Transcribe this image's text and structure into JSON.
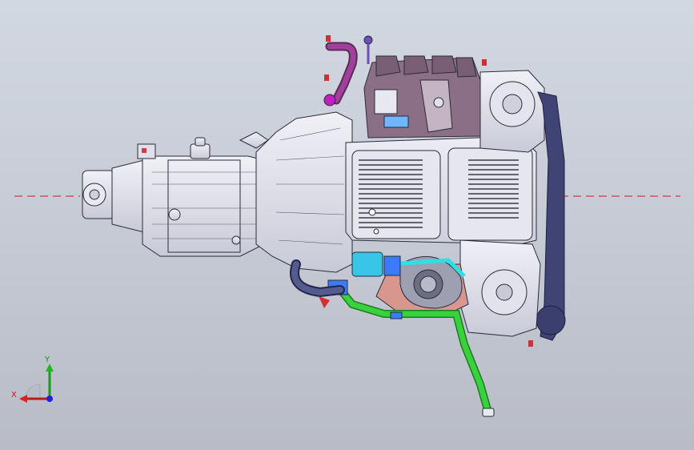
{
  "viewport": {
    "background_top": "#d2d8e2",
    "background_bottom": "#b9bcc7",
    "centerline_color": "#d23c3c"
  },
  "model": {
    "metal_color": "#dfe0ea",
    "edge_color": "#2b2b3a",
    "hose_green": "#37d23c",
    "hose_cyan": "#2ce0e6",
    "hose_blue": "#3a7bff",
    "hose_magenta": "#a0409a",
    "belt_navy": "#3f4474",
    "flange_salmon": "#d8978e"
  },
  "triad": {
    "x_label": "X",
    "y_label": "Y",
    "x_color": "#e02020",
    "y_color": "#1fb81f",
    "z_color": "#2020e0"
  }
}
